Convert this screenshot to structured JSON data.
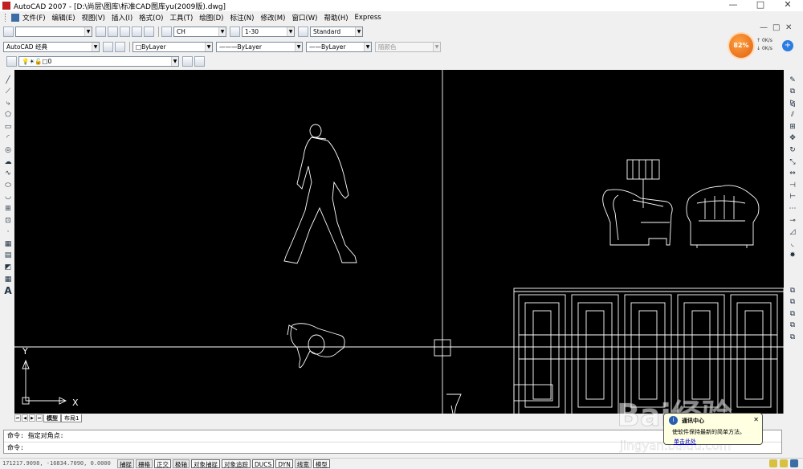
{
  "window": {
    "title": "AutoCAD 2007 - [D:\\尚层\\图库\\标准CAD图库yu(2009版).dwg]",
    "minimize": "—",
    "maximize": "□",
    "close": "✕"
  },
  "menu": {
    "items": [
      "文件(F)",
      "编辑(E)",
      "视图(V)",
      "插入(I)",
      "格式(O)",
      "工具(T)",
      "绘图(D)",
      "标注(N)",
      "修改(M)",
      "窗口(W)",
      "帮助(H)",
      "Express"
    ],
    "mdi_controls": [
      "—",
      "□",
      "✕"
    ]
  },
  "toolbar_standard": {
    "text_style": "CH",
    "dim_style": "1-30",
    "table_style": "Standard"
  },
  "toolbar_workspace": {
    "workspace": "AutoCAD 经典"
  },
  "toolbar_properties": {
    "color": "ByLayer",
    "linetype": "ByLayer",
    "lineweight": "ByLayer",
    "plotstyle": "随颜色"
  },
  "toolbar_layers": {
    "current_layer": "0"
  },
  "speed_widget": {
    "percent": "82%",
    "up": "0K/s",
    "down": "0K/s",
    "plus": "+"
  },
  "canvas": {
    "background": "#000000",
    "line_color": "#ffffff",
    "ucs_x": "X",
    "ucs_y": "Y"
  },
  "layout_tabs": {
    "nav": [
      "⏮",
      "◀",
      "▶",
      "⏭"
    ],
    "tabs": [
      "模型",
      "布局1"
    ],
    "active": "模型"
  },
  "command": {
    "line1": "命令: 指定对角点:",
    "line2": "命令:"
  },
  "balloon": {
    "title": "通讯中心",
    "message": "使软件保持最新的简单方法。",
    "link": "单击此处",
    "close": "✕",
    "info_icon": "i"
  },
  "status": {
    "coords": "171217.9098, -16834.7090, 0.0000",
    "buttons": [
      "捕捉",
      "栅格",
      "正交",
      "极轴",
      "对象捕捉",
      "对象追踪",
      "DUCS",
      "DYN",
      "线宽",
      "模型"
    ],
    "on_buttons": [
      "正交",
      "对象捕捉",
      "对象追踪",
      "DUCS",
      "DYN",
      "模型"
    ]
  },
  "watermark": {
    "text": "Bai经验",
    "url": "jingyan.baidu.com"
  }
}
